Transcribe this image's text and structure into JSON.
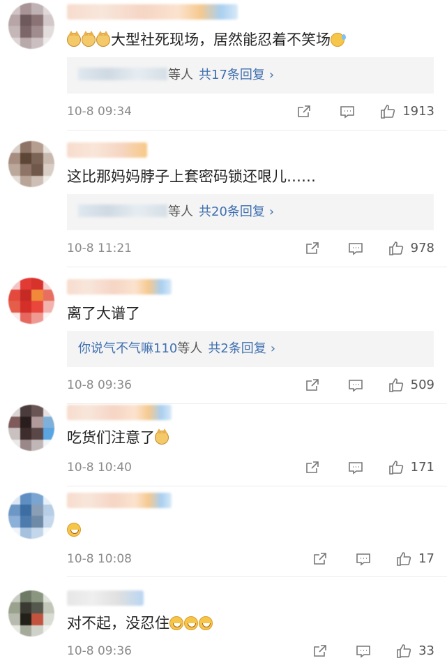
{
  "comments": [
    {
      "text": "大型社死现场，居然能忍着不笑场",
      "reply": {
        "name_suffix": "等人",
        "count_label": "共17条回复"
      },
      "time": "10-8 09:34",
      "likes": "1913"
    },
    {
      "text": "这比那妈妈脖子上套密码锁还哏儿……",
      "reply": {
        "name_suffix": "等人",
        "count_label": "共20条回复"
      },
      "time": "10-8 11:21",
      "likes": "978"
    },
    {
      "text": "离了大谱了",
      "reply": {
        "name_prefix": "你说气不气嘛110",
        "name_suffix": "等人",
        "count_label": "共2条回复"
      },
      "time": "10-8 09:36",
      "likes": "509"
    },
    {
      "text": "吃货们注意了",
      "time": "10-8 10:40",
      "likes": "171"
    },
    {
      "text": "",
      "time": "10-8 10:08",
      "likes": "17"
    },
    {
      "text": "对不起，没忍住",
      "time": "10-8 09:36",
      "likes": "33"
    }
  ],
  "icons": {
    "share": "share-icon",
    "comment": "comment-icon",
    "like": "like-icon",
    "chevron": "chevron-right-icon",
    "emoji_doge": "doge-emoji-icon",
    "emoji_sweat": "sweat-smile-emoji-icon",
    "emoji_laugh": "laugh-cry-emoji-icon"
  },
  "colors": {
    "link": "#3f6fb0",
    "meta": "#8a8a8a",
    "reply_bg": "#f4f4f4"
  }
}
